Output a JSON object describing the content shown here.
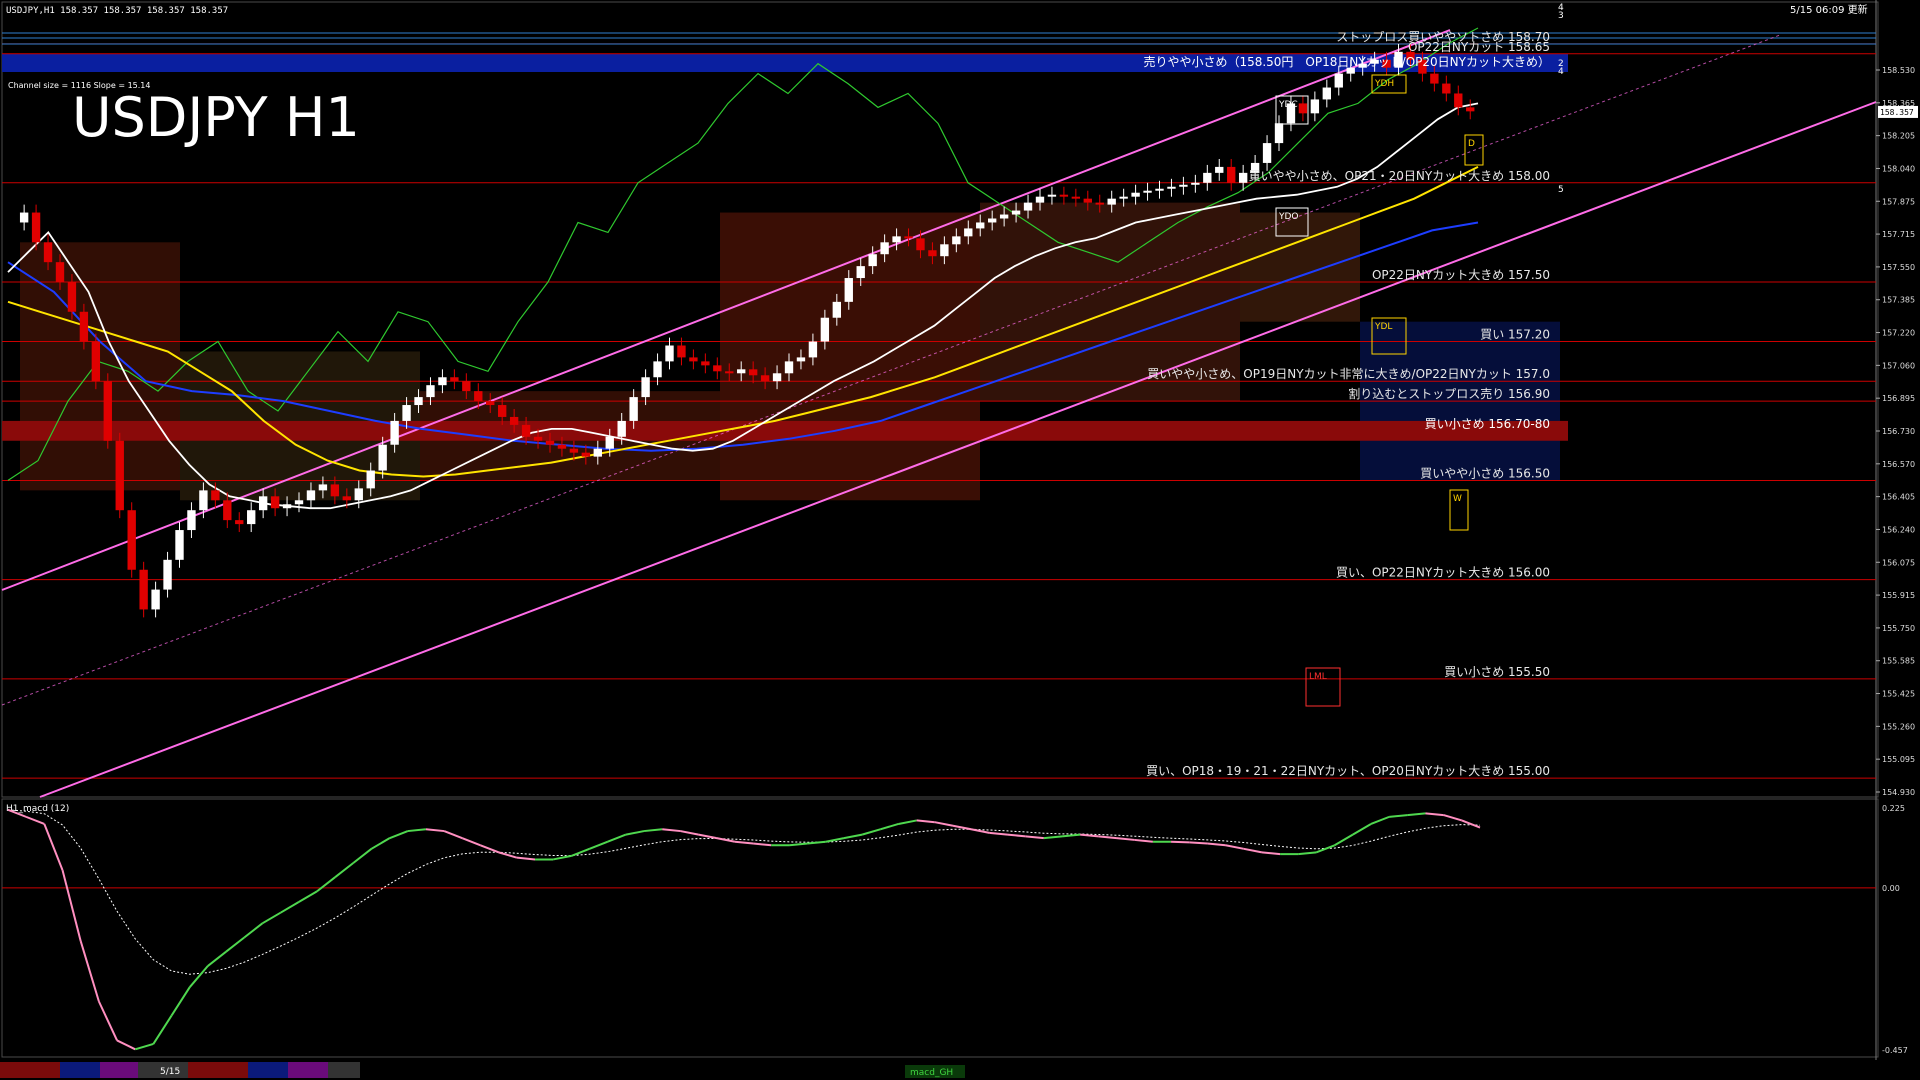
{
  "header": {
    "quote": "USDJPY,H1  158.357 158.357 158.357 158.357",
    "timestamp": "5/15 06:09 更新"
  },
  "main_title": "USDJPY H1",
  "channel_info": "Channel size = 1116 Slope = 15.14",
  "current_price": "158.357",
  "price_axis_labels": [
    "158.530",
    "158.365",
    "158.205",
    "158.040",
    "157.875",
    "157.715",
    "157.550",
    "157.385",
    "157.220",
    "157.060",
    "156.895",
    "156.730",
    "156.570",
    "156.405",
    "156.240",
    "156.075",
    "155.915",
    "155.750",
    "155.585",
    "155.425",
    "155.260",
    "155.095",
    "154.930"
  ],
  "order_levels": [
    {
      "price": 158.7,
      "label": "ストップロス買いややソトさめ 158.70",
      "color": "#e8e8e8"
    },
    {
      "price": 158.65,
      "label": "OP22日NYカット 158.65",
      "color": "#e8e8e8"
    },
    {
      "price": 158.5,
      "label": "売りやや小さめ（158.50円　OP18日NYカット/OP20日NYカット大きめ）",
      "color": "#ffffff",
      "band": true
    },
    {
      "price": 158.0,
      "label": "買いやや小さめ、OP21・20日NYカット大きめ 158.00",
      "color": "#e8e8e8"
    },
    {
      "price": 157.5,
      "label": "OP22日NYカット大きめ 157.50",
      "color": "#e8e8e8"
    },
    {
      "price": 157.2,
      "label": "買い 157.20",
      "color": "#e8e8e8"
    },
    {
      "price": 157.0,
      "label": "買いやや小さめ、OP19日NYカット非常に大きめ/OP22日NYカット 157.0",
      "color": "#e8e8e8"
    },
    {
      "price": 156.9,
      "label": "割り込むとストップロス売り 156.90",
      "color": "#e8e8e8"
    },
    {
      "price": 156.75,
      "label": "買い小さめ 156.70-80",
      "color": "#ffffff",
      "band": true
    },
    {
      "price": 156.5,
      "label": "買いやや小さめ 156.50",
      "color": "#e8e8e8"
    },
    {
      "price": 156.0,
      "label": "買い、OP22日NYカット大きめ 156.00",
      "color": "#e8e8e8"
    },
    {
      "price": 155.5,
      "label": "買い小さめ 155.50",
      "color": "#e8e8e8"
    },
    {
      "price": 155.0,
      "label": "買い、OP18・19・21・22日NYカット、OP20日NYカット大きめ 155.00",
      "color": "#e8e8e8"
    }
  ],
  "box_markers": [
    {
      "text": "YDC",
      "color": "#ffffff"
    },
    {
      "text": "YDH",
      "color": "#ffd400"
    },
    {
      "text": "YDO",
      "color": "#ffffff"
    },
    {
      "text": "YDL",
      "color": "#ffd400"
    },
    {
      "text": "D",
      "color": "#ffd400"
    },
    {
      "text": "W",
      "color": "#ffd400"
    },
    {
      "text": "LML",
      "color": "#ff3030"
    }
  ],
  "channel_numbers": [
    "4",
    "3",
    "2",
    "4",
    "5"
  ],
  "chart_data": {
    "type": "line",
    "title": "USDJPY H1",
    "x_unit": "hourly bars",
    "ylim": [
      154.93,
      158.78
    ],
    "price_close": [
      157.8,
      157.85,
      157.7,
      157.6,
      157.5,
      157.35,
      157.2,
      157.0,
      156.7,
      156.35,
      156.05,
      155.85,
      155.95,
      156.1,
      156.25,
      156.35,
      156.45,
      156.4,
      156.3,
      156.28,
      156.35,
      156.42,
      156.36,
      156.38,
      156.4,
      156.45,
      156.48,
      156.42,
      156.4,
      156.46,
      156.55,
      156.68,
      156.8,
      156.88,
      156.92,
      156.98,
      157.02,
      157.0,
      156.95,
      156.9,
      156.88,
      156.82,
      156.78,
      156.72,
      156.7,
      156.68,
      156.66,
      156.64,
      156.62,
      156.66,
      156.72,
      156.8,
      156.92,
      157.02,
      157.1,
      157.18,
      157.12,
      157.1,
      157.08,
      157.05,
      157.04,
      157.06,
      157.03,
      157.0,
      157.04,
      157.1,
      157.12,
      157.2,
      157.32,
      157.4,
      157.52,
      157.58,
      157.64,
      157.7,
      157.73,
      157.72,
      157.66,
      157.63,
      157.69,
      157.73,
      157.77,
      157.8,
      157.82,
      157.84,
      157.86,
      157.9,
      157.93,
      157.94,
      157.93,
      157.92,
      157.9,
      157.89,
      157.92,
      157.93,
      157.95,
      157.96,
      157.97,
      157.98,
      157.99,
      158.0,
      158.05,
      158.08,
      158.0,
      158.05,
      158.1,
      158.2,
      158.3,
      158.4,
      158.35,
      158.42,
      158.48,
      158.55,
      158.58,
      158.6,
      158.62,
      158.58,
      158.66,
      158.62,
      158.55,
      158.5,
      158.45,
      158.38,
      158.36
    ],
    "ma_white": [
      157.55,
      157.65,
      157.75,
      157.6,
      157.45,
      157.2,
      157.0,
      156.85,
      156.7,
      156.58,
      156.48,
      156.42,
      156.4,
      156.38,
      156.37,
      156.36,
      156.36,
      156.38,
      156.4,
      156.42,
      156.45,
      156.5,
      156.55,
      156.6,
      156.65,
      156.7,
      156.74,
      156.76,
      156.76,
      156.74,
      156.72,
      156.7,
      156.68,
      156.66,
      156.65,
      156.66,
      156.7,
      156.76,
      156.82,
      156.88,
      156.94,
      157.0,
      157.05,
      157.1,
      157.16,
      157.22,
      157.28,
      157.36,
      157.44,
      157.52,
      157.58,
      157.63,
      157.67,
      157.7,
      157.72,
      157.76,
      157.8,
      157.82,
      157.84,
      157.86,
      157.88,
      157.9,
      157.92,
      157.93,
      157.94,
      157.96,
      157.98,
      158.02,
      158.08,
      158.16,
      158.24,
      158.32,
      158.38,
      158.4
    ],
    "ma_yellow": [
      157.4,
      157.35,
      157.3,
      157.25,
      157.2,
      157.15,
      157.05,
      156.95,
      156.8,
      156.68,
      156.6,
      156.55,
      156.53,
      156.52,
      156.53,
      156.55,
      156.57,
      156.59,
      156.62,
      156.65,
      156.68,
      156.71,
      156.74,
      156.77,
      156.8,
      156.84,
      156.88,
      156.92,
      156.97,
      157.02,
      157.08,
      157.14,
      157.2,
      157.26,
      157.32,
      157.38,
      157.44,
      157.5,
      157.56,
      157.62,
      157.68,
      157.74,
      157.8,
      157.86,
      157.92,
      158.0,
      158.08
    ],
    "ma_blue": [
      157.6,
      157.45,
      157.2,
      157.0,
      156.95,
      156.93,
      156.9,
      156.85,
      156.8,
      156.76,
      156.73,
      156.7,
      156.68,
      156.66,
      156.65,
      156.66,
      156.68,
      156.71,
      156.75,
      156.8,
      156.88,
      156.96,
      157.04,
      157.12,
      157.2,
      157.28,
      157.36,
      157.44,
      157.52,
      157.6,
      157.68,
      157.76,
      157.8
    ],
    "chikou_green": [
      156.5,
      156.6,
      156.9,
      157.1,
      157.05,
      156.95,
      157.1,
      157.2,
      156.95,
      156.85,
      157.05,
      157.25,
      157.1,
      157.35,
      157.3,
      157.1,
      157.05,
      157.3,
      157.5,
      157.8,
      157.75,
      158.0,
      158.1,
      158.2,
      158.4,
      158.55,
      158.45,
      158.6,
      158.5,
      158.38,
      158.45,
      158.3,
      158.0,
      157.9,
      157.8,
      157.7,
      157.65,
      157.6,
      157.7,
      157.8,
      157.88,
      157.95,
      158.05,
      158.2,
      158.35,
      158.4,
      158.52,
      158.6,
      158.7,
      158.78
    ],
    "macd": {
      "label": "H1_macd (12)",
      "axis_labels": [
        "0.225",
        "0.00",
        "-0.457"
      ],
      "ylim": [
        -0.457,
        0.225
      ],
      "values": [
        0.22,
        0.2,
        0.18,
        0.05,
        -0.15,
        -0.32,
        -0.43,
        -0.455,
        -0.44,
        -0.36,
        -0.28,
        -0.22,
        -0.18,
        -0.14,
        -0.1,
        -0.07,
        -0.04,
        -0.01,
        0.03,
        0.07,
        0.11,
        0.14,
        0.16,
        0.165,
        0.16,
        0.14,
        0.12,
        0.1,
        0.085,
        0.08,
        0.08,
        0.09,
        0.11,
        0.13,
        0.15,
        0.16,
        0.165,
        0.16,
        0.15,
        0.14,
        0.13,
        0.125,
        0.12,
        0.12,
        0.125,
        0.13,
        0.14,
        0.15,
        0.165,
        0.18,
        0.19,
        0.185,
        0.175,
        0.165,
        0.155,
        0.15,
        0.145,
        0.14,
        0.145,
        0.15,
        0.145,
        0.14,
        0.135,
        0.13,
        0.13,
        0.128,
        0.125,
        0.12,
        0.11,
        0.1,
        0.095,
        0.095,
        0.1,
        0.12,
        0.15,
        0.18,
        0.2,
        0.205,
        0.21,
        0.205,
        0.19,
        0.17
      ]
    }
  },
  "bottom_bar": {
    "date_tab": "5/15",
    "indicator_tab": "macd_GH"
  },
  "colors": {
    "background": "#000000",
    "candle_up": "#ffffff",
    "candle_down": "#e00000",
    "level_line": "#cc0000",
    "channel": "#ff6ce8",
    "blue_band": "#0a1fa0",
    "red_band": "#8a0a0a",
    "ma_white": "#ffffff",
    "ma_yellow": "#ffe400",
    "ma_blue": "#1d3dff",
    "chikou": "#2fc92f",
    "macd_up": "#4fd84f",
    "macd_down": "#ff8fc0"
  }
}
